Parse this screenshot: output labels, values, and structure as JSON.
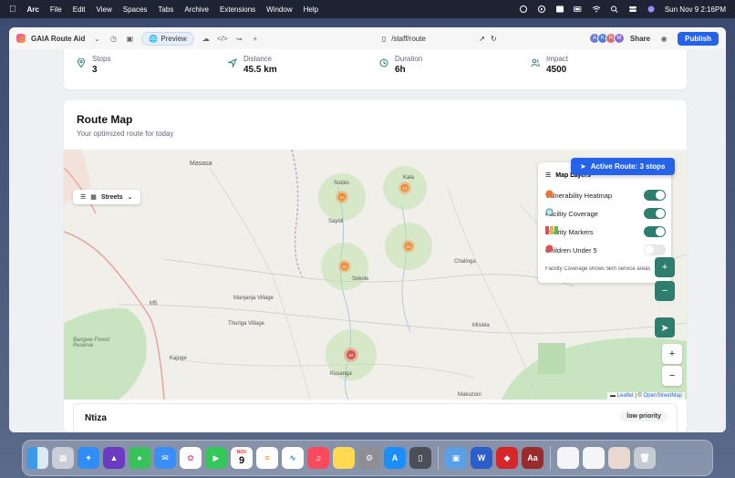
{
  "menubar": {
    "app": "Arc",
    "menus": [
      "File",
      "Edit",
      "View",
      "Spaces",
      "Tabs",
      "Archive",
      "Extensions",
      "Window",
      "Help"
    ],
    "clock": "Sun Nov 9  2:16PM"
  },
  "browser": {
    "title": "GAIA Route Aid",
    "preview_label": "Preview",
    "url": "/staff/route",
    "avatars": [
      {
        "letter": "A",
        "color": "#6b7bd6"
      },
      {
        "letter": "K",
        "color": "#4f7cd8"
      },
      {
        "letter": "R",
        "color": "#d86a6a"
      },
      {
        "letter": "M",
        "color": "#8b6bd6"
      }
    ],
    "share_label": "Share",
    "publish_label": "Publish"
  },
  "stats": [
    {
      "label": "Stops",
      "value": "3"
    },
    {
      "label": "Distance",
      "value": "45.5 km"
    },
    {
      "label": "Duration",
      "value": "6h"
    },
    {
      "label": "Impact",
      "value": "4500"
    }
  ],
  "route_map": {
    "title": "Route Map",
    "subtitle": "Your optimized route for today",
    "layer_label": "Streets",
    "active_route": "Active Route: 3 stops",
    "legend_title": "Map Layers",
    "layers": [
      {
        "label": "Vulnerability Heatmap",
        "on": true
      },
      {
        "label": "Facility Coverage",
        "on": true
      },
      {
        "label": "Priority Markers",
        "on": true
      },
      {
        "label": "Children Under 5",
        "on": false
      }
    ],
    "legend_note": "Facility Coverage shows 5km service areas",
    "zoom_in": "+",
    "zoom_out": "−",
    "attribution_leaflet": "Leaflet",
    "attribution_sep": " | © ",
    "attribution_osm": "OpenStreetMap",
    "places": [
      "Masasa",
      "Sololo",
      "Kala",
      "Sayidi",
      "Sokole",
      "Chalinga",
      "M5",
      "Manjanja Village",
      "Thuriga Village",
      "Bangwe Forest Reserve",
      "Misiela",
      "Kajuge",
      "Kusanga",
      "Makuzoni"
    ],
    "markers": [
      "10",
      "13",
      "24",
      "16",
      "32"
    ]
  },
  "stop": {
    "name": "Ntiza",
    "priority": "low priority"
  },
  "dock": {
    "calendar_month": "NOV",
    "calendar_day": "9",
    "apps": [
      "finder",
      "launchpad",
      "safari",
      "affinity",
      "messages",
      "mail",
      "photos",
      "facetime",
      "calendar",
      "reminders",
      "freeform",
      "music",
      "notes",
      "system-settings",
      "app-store",
      "iphone-mirroring",
      "preview",
      "word",
      "acrobat",
      "dictionary"
    ]
  },
  "colors": {
    "accent": "#2563eb",
    "teal": "#2e7d6e"
  }
}
